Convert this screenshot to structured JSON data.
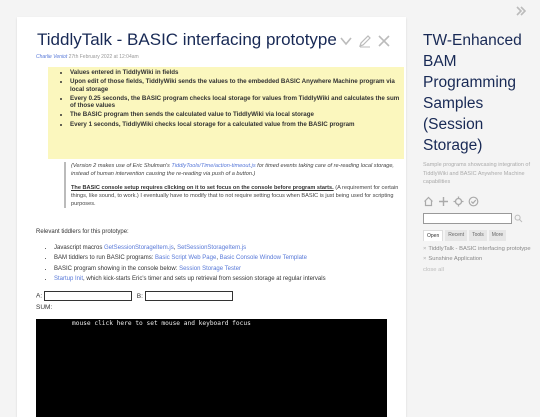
{
  "story": {
    "title": "TiddlyTalk - BASIC interfacing prototype",
    "author": "Charlie Veniot",
    "date": "27th February 2022 at 12:04am",
    "highlights": [
      "Values entered in TiddlyWiki in fields",
      "Upon edit of those fields, TiddlyWiki sends the values to the embedded BASIC Anywhere Machine program via local storage",
      "Every 0.25 seconds, the BASIC program checks local storage for values from TiddlyWiki and calculates the sum of those values",
      "The BASIC program then sends the calculated value to TiddlyWiki via local storage",
      "Every 1 seconds, TiddlyWiki checks local storage for a calculated value from the BASIC program"
    ],
    "note": {
      "p1_pre": "(Version 2 makes use of Eric Shulman's ",
      "p1_link": "TiddlyTools/Time/action-timeout.js",
      "p1_post": " for timed events taking care of re-reading local storage, instead of human intervention causing the re-reading via push of a button.)",
      "p2_strong": "The BASIC console setup requires clicking on it to set focus on the console before program starts.",
      "p2_rest": " (A requirement for certain things, like sound, to work.) I eventually have to modify that to not require setting focus when BASIC is just being used for scripting purposes."
    },
    "relevant_label": "Relevant tiddlers for this prototype:",
    "relevant": {
      "js_pre": "Javascript macros ",
      "js_link1": "GetSessionStorageItem.js",
      "js_sep": ", ",
      "js_link2": "SetSessionStorageItem.js",
      "bam_pre": "BAM tiddlers to run BASIC programs: ",
      "bam_link1": "Basic Script Web Page",
      "bam_sep": ", ",
      "bam_link2": "Basic Console Window Template",
      "prog_pre": "BASIC program showing in the console below: ",
      "prog_link": "Session Storage Tester",
      "startup_link": "Startup Init",
      "startup_post": ", which kick-starts Eric's timer and sets up retrieval from session storage at regular intervals"
    },
    "field_a_label": "A:",
    "field_b_label": "B:",
    "sum_label": "SUM:",
    "console_text": "mouse click here to set mouse and keyboard focus"
  },
  "sidebar": {
    "site_title": "TW-Enhanced BAM Programming Samples (Session Storage)",
    "site_subtitle": "Sample programs showcasing integration of TiddlyWiki and BASIC Anywhere Machine capabilities",
    "tabs": [
      "Open",
      "Recent",
      "Tools",
      "More"
    ],
    "open_items": [
      "TiddlyTalk - BASIC interfacing prototype",
      "Sunshine Application"
    ],
    "close_all": "close all",
    "x_mark": "×"
  },
  "colors": {
    "title": "#182955",
    "link": "#5778d8",
    "highlight_bg": "#fbf7be",
    "console_bg": "#000000"
  },
  "icons": [
    "chevron-double-right-icon",
    "chevron-down-icon",
    "pencil-icon",
    "close-icon",
    "home-icon",
    "plus-icon",
    "gear-icon",
    "check-circle-icon",
    "search-icon"
  ]
}
